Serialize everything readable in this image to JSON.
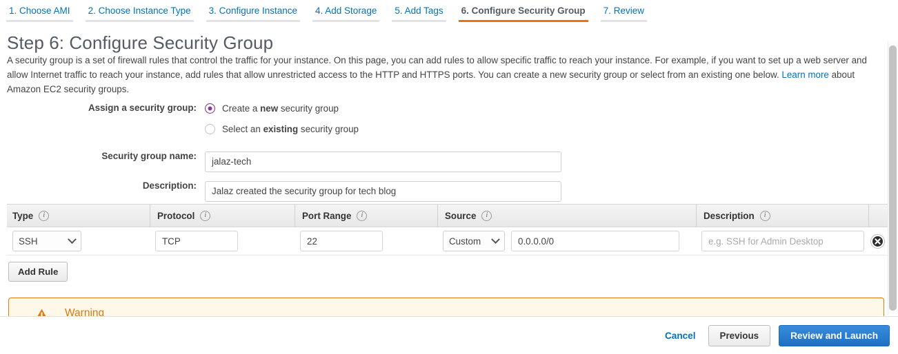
{
  "wizard": {
    "tabs": [
      {
        "label": "1. Choose AMI",
        "active": false
      },
      {
        "label": "2. Choose Instance Type",
        "active": false
      },
      {
        "label": "3. Configure Instance",
        "active": false
      },
      {
        "label": "4. Add Storage",
        "active": false
      },
      {
        "label": "5. Add Tags",
        "active": false
      },
      {
        "label": "6. Configure Security Group",
        "active": true
      },
      {
        "label": "7. Review",
        "active": false
      }
    ],
    "active_color": "#ec7211",
    "link_color": "#0073bb"
  },
  "page": {
    "title": "Step 6: Configure Security Group",
    "intro_part1": "A security group is a set of firewall rules that control the traffic for your instance. On this page, you can add rules to allow specific traffic to reach your instance. For example, if you want to set up a web server and allow Internet traffic to reach your instance, add rules that allow unrestricted access to the HTTP and HTTPS ports. You can create a new security group or select from an existing one below. ",
    "learn_more": "Learn more",
    "intro_part2": " about Amazon EC2 security groups."
  },
  "assign": {
    "label": "Assign a security group:",
    "option_new_pre": "Create a ",
    "option_new_bold": "new",
    "option_new_post": " security group",
    "option_existing_pre": "Select an ",
    "option_existing_bold": "existing",
    "option_existing_post": " security group",
    "selected": "new",
    "radio_color": "#8b3a8e"
  },
  "fields": {
    "name_label": "Security group name:",
    "name_value": "jalaz-tech",
    "description_label": "Description:",
    "description_value": "Jalaz created the security group for tech blog"
  },
  "rules_table": {
    "columns": [
      {
        "label": "Type",
        "info": "i"
      },
      {
        "label": "Protocol",
        "info": "i"
      },
      {
        "label": "Port Range",
        "info": "i"
      },
      {
        "label": "Source",
        "info": "i"
      },
      {
        "label": "Description",
        "info": "i"
      }
    ],
    "rows": [
      {
        "type": "SSH",
        "protocol": "TCP",
        "port_range": "22",
        "source_kind": "Custom",
        "source_value": "0.0.0.0/0",
        "description_value": "",
        "description_placeholder": "e.g. SSH for Admin Desktop"
      }
    ],
    "add_rule_label": "Add Rule"
  },
  "warning": {
    "title": "Warning",
    "accent": "#e07b18",
    "background": "#fdf8e8"
  },
  "footer": {
    "cancel": "Cancel",
    "previous": "Previous",
    "review_and_launch": "Review and Launch",
    "primary_color": "#2a7fce"
  }
}
